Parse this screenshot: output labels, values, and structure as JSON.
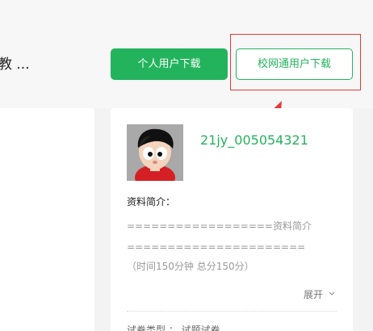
{
  "document": {
    "title_fragment": "教 ..."
  },
  "actions": {
    "personal_download": "个人用户下载",
    "school_download": "校网通用户下载"
  },
  "profile": {
    "username": "21jy_005054321",
    "intro_label": "资料简介：",
    "intro_lines": [
      "==================资料简介",
      "======================",
      "（时间150分钟 总分150分）"
    ],
    "expand_label": "展开"
  },
  "partial": {
    "bottom_text": "试卷类型 ：  试题试卷"
  },
  "colors": {
    "accent": "#23b35d",
    "annotation": "#e53935"
  },
  "icons": {
    "avatar": "cartoon-boy-avatar",
    "expand": "chevron-down-icon",
    "annotation": "red-arrow-icon"
  }
}
